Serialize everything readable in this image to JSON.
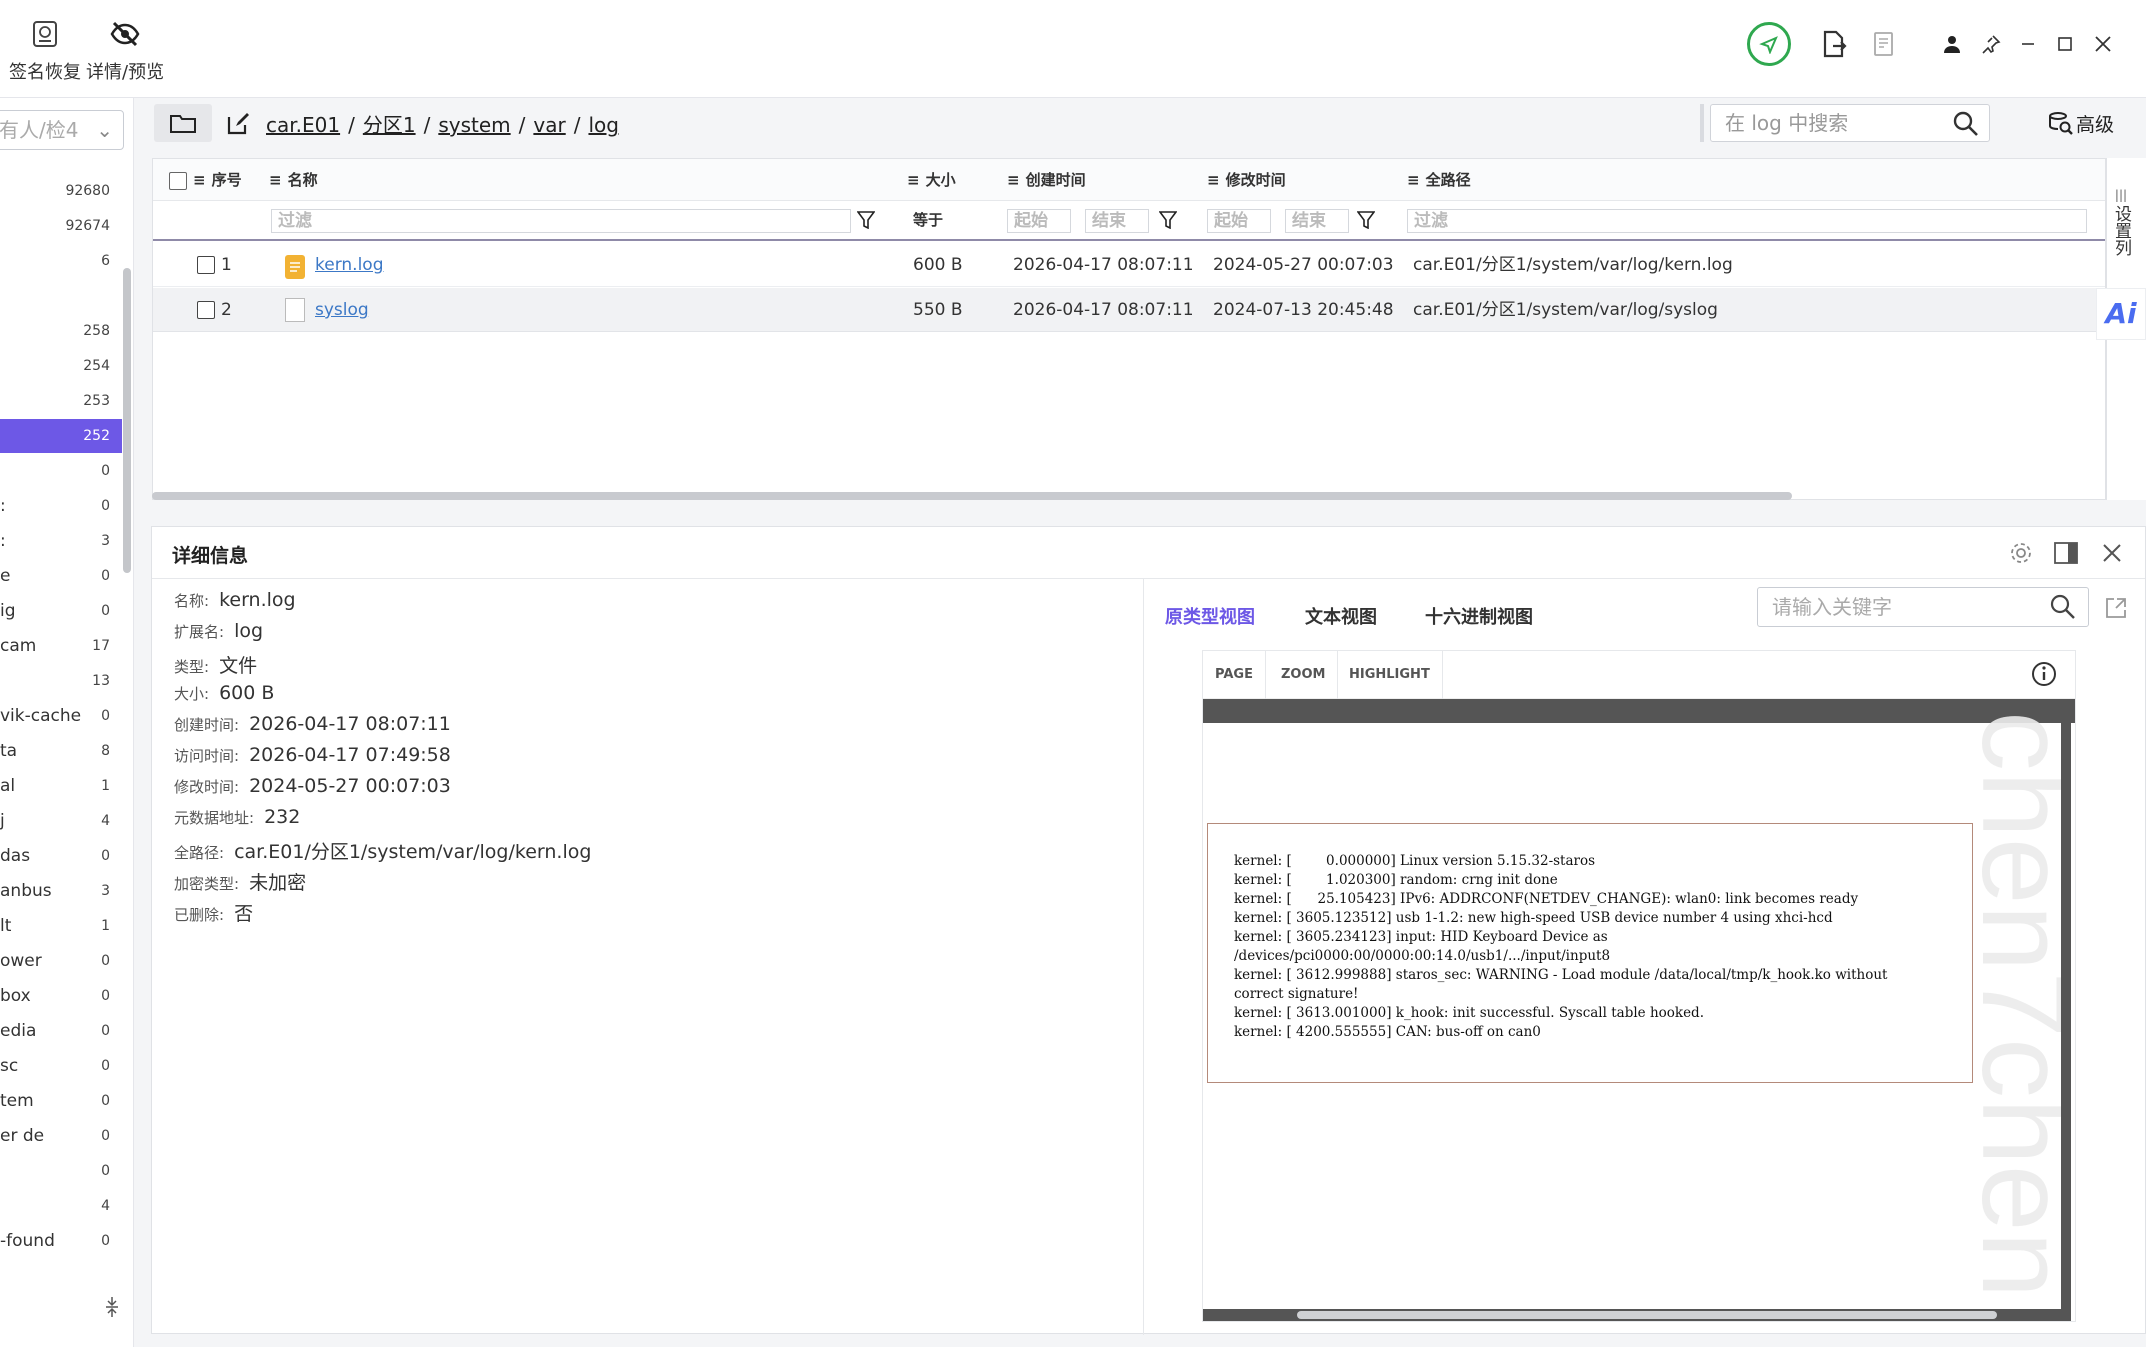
{
  "toolbar": {
    "restore_label": "签名恢复",
    "preview_label": "详情/预览",
    "restore_icon": "signature-restore-icon",
    "preview_icon": "eye-off-icon"
  },
  "window": {
    "status_icon": "send-circle-icon",
    "export_icon": "file-export-icon",
    "report_icon": "report-icon",
    "user_icon": "user-icon",
    "pin_icon": "pin-icon"
  },
  "sidebar": {
    "select_text": "有人/检4",
    "items": [
      {
        "name": "",
        "count": "92680"
      },
      {
        "name": "",
        "count": "92674"
      },
      {
        "name": "",
        "count": "6"
      },
      {
        "name": "",
        "count": ""
      },
      {
        "name": "",
        "count": "258"
      },
      {
        "name": "",
        "count": "254"
      },
      {
        "name": "",
        "count": "253"
      },
      {
        "name": "",
        "count": "252"
      },
      {
        "name": "",
        "count": "0"
      },
      {
        "name": ":",
        "count": "0"
      },
      {
        "name": ":",
        "count": "3"
      },
      {
        "name": "e",
        "count": "0"
      },
      {
        "name": "ig",
        "count": "0"
      },
      {
        "name": "cam",
        "count": "17"
      },
      {
        "name": "",
        "count": "13"
      },
      {
        "name": "vik-cache",
        "count": "0"
      },
      {
        "name": "ta",
        "count": "8"
      },
      {
        "name": "al",
        "count": "1"
      },
      {
        "name": "j",
        "count": "4"
      },
      {
        "name": "das",
        "count": "0"
      },
      {
        "name": "anbus",
        "count": "3"
      },
      {
        "name": "lt",
        "count": "1"
      },
      {
        "name": "ower",
        "count": "0"
      },
      {
        "name": "box",
        "count": "0"
      },
      {
        "name": "edia",
        "count": "0"
      },
      {
        "name": "sc",
        "count": "0"
      },
      {
        "name": "tem",
        "count": "0"
      },
      {
        "name": "er de",
        "count": "0"
      },
      {
        "name": "",
        "count": "0"
      },
      {
        "name": "",
        "count": "4"
      },
      {
        "name": "-found",
        "count": "0"
      }
    ],
    "active_count": "252"
  },
  "path": {
    "segments": [
      "car.E01",
      "分区1",
      "system",
      "var",
      "log"
    ],
    "sep": "/"
  },
  "search": {
    "placeholder": "在 log 中搜索",
    "advanced": "高级"
  },
  "table": {
    "headers": {
      "index": "序号",
      "name": "名称",
      "size": "大小",
      "created": "创建时间",
      "modified": "修改时间",
      "fullpath": "全路径"
    },
    "filters": {
      "name": "过滤",
      "size": "等于",
      "start": "起始",
      "end": "结束",
      "path": "过滤"
    },
    "rows": [
      {
        "index": "1",
        "name": "kern.log",
        "size": "600 B",
        "created": "2026-04-17 08:07:11",
        "modified": "2024-05-27 00:07:03",
        "path": "car.E01/分区1/system/var/log/kern.log"
      },
      {
        "index": "2",
        "name": "syslog",
        "size": "550 B",
        "created": "2026-04-17 08:07:11",
        "modified": "2024-07-13 20:45:48",
        "path": "car.E01/分区1/system/var/log/syslog"
      }
    ],
    "column_settings": "设置列",
    "ai_label": "Ai"
  },
  "detail": {
    "title": "详细信息",
    "props": [
      {
        "k": "名称:",
        "v": "kern.log"
      },
      {
        "k": "扩展名:",
        "v": "log"
      },
      {
        "k": "类型:",
        "v": "文件"
      },
      {
        "k": "大小:",
        "v": "600 B"
      },
      {
        "k": "创建时间:",
        "v": "2026-04-17 08:07:11"
      },
      {
        "k": "访问时间:",
        "v": "2026-04-17 07:49:58"
      },
      {
        "k": "修改时间:",
        "v": "2024-05-27 00:07:03"
      },
      {
        "k": "元数据地址:",
        "v": "232"
      },
      {
        "k": "全路径:",
        "v": "car.E01/分区1/system/var/log/kern.log"
      },
      {
        "k": "加密类型:",
        "v": "未加密"
      },
      {
        "k": "已删除:",
        "v": "否"
      }
    ],
    "tabs": [
      "原类型视图",
      "文本视图",
      "十六进制视图"
    ],
    "keyword_placeholder": "请输入关键字",
    "viewer_buttons": [
      "PAGE",
      "ZOOM",
      "HIGHLIGHT"
    ],
    "log_lines": [
      "kernel: [        0.000000] Linux version 5.15.32-staros",
      "kernel: [        1.020300] random: crng init done",
      "kernel: [      25.105423] IPv6: ADDRCONF(NETDEV_CHANGE): wlan0: link becomes ready",
      "kernel: [ 3605.123512] usb 1-1.2: new high-speed USB device number 4 using xhci-hcd",
      "kernel: [ 3605.234123] input: HID Keyboard Device as",
      "/devices/pci0000:00/0000:00:14.0/usb1/.../input/input8",
      "kernel: [ 3612.999888] staros_sec: WARNING - Load module /data/local/tmp/k_hook.ko without",
      "correct signature!",
      "kernel: [ 3613.001000] k_hook: init successful. Syscall table hooked.",
      "kernel: [ 4200.555555] CAN: bus-off on can0"
    ],
    "watermark": "chen7chen"
  },
  "colors": {
    "accent": "#6d58e6",
    "link": "#3c78c6",
    "status": "#2fa84f"
  }
}
